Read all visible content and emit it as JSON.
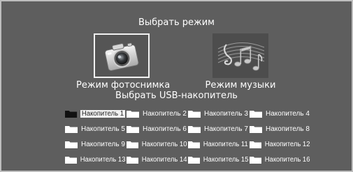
{
  "screen": {
    "title": "Выбрать режим",
    "usb_title": "Выбрать USB-накопитель"
  },
  "modes": [
    {
      "label": "Режим фотоснимка",
      "icon": "camera-icon",
      "selected": true
    },
    {
      "label": "Режим музыки",
      "icon": "music-notes-icon",
      "selected": false
    }
  ],
  "drives": [
    {
      "label": "Накопитель 1",
      "selected": true
    },
    {
      "label": "Накопитель 2",
      "selected": false
    },
    {
      "label": "Накопитель 3",
      "selected": false
    },
    {
      "label": "Накопитель 4",
      "selected": false
    },
    {
      "label": "Накопитель 5",
      "selected": false
    },
    {
      "label": "Накопитель 6",
      "selected": false
    },
    {
      "label": "Накопитель 7",
      "selected": false
    },
    {
      "label": "Накопитель 8",
      "selected": false
    },
    {
      "label": "Накопитель 9",
      "selected": false
    },
    {
      "label": "Накопитель 10",
      "selected": false
    },
    {
      "label": "Накопитель 11",
      "selected": false
    },
    {
      "label": "Накопитель 12",
      "selected": false
    },
    {
      "label": "Накопитель 13",
      "selected": false
    },
    {
      "label": "Накопитель 14",
      "selected": false
    },
    {
      "label": "Накопитель 15",
      "selected": false
    },
    {
      "label": "Накопитель 16",
      "selected": false
    }
  ],
  "colors": {
    "background": "#5e5e5e",
    "border": "#bdbdbd",
    "text": "#ffffff",
    "selected_bg": "#f2f2f2",
    "folder": "#ffffff",
    "folder_selected": "#111111"
  }
}
